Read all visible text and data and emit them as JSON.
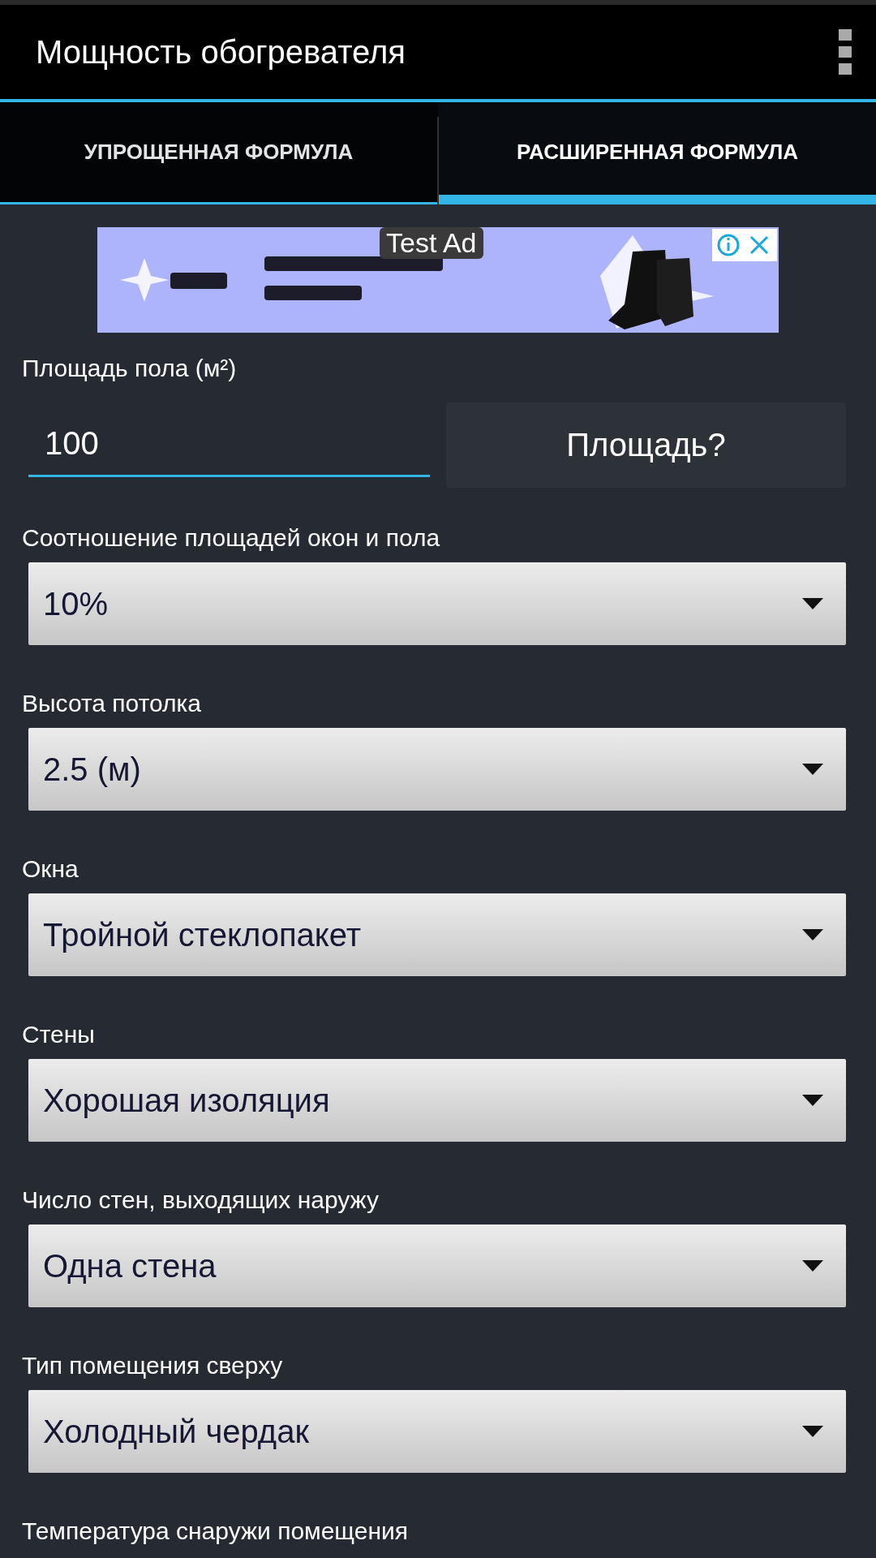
{
  "app_bar": {
    "title": "Мощность обогревателя"
  },
  "tabs": [
    {
      "label": "УПРОЩЕННАЯ ФОРМУЛА",
      "selected": false
    },
    {
      "label": "РАСШИРЕННАЯ ФОРМУЛА",
      "selected": true
    }
  ],
  "ad": {
    "kind": "picture",
    "label": "Test Ad"
  },
  "area": {
    "label": "Площадь пола (м²)",
    "value": "100",
    "button": "Площадь?"
  },
  "fields": [
    {
      "label": "Соотношение площадей окон и пола",
      "value": "10%"
    },
    {
      "label": "Высота потолка",
      "value": "2.5 (м)"
    },
    {
      "label": "Окна",
      "value": "Тройной стеклопакет"
    },
    {
      "label": "Стены",
      "value": "Хорошая изоляция"
    },
    {
      "label": "Число стен, выходящих наружу",
      "value": "Одна стена"
    },
    {
      "label": "Тип помещения сверху",
      "value": "Холодный чердак"
    },
    {
      "label": "Температура снаружи помещения"
    }
  ]
}
